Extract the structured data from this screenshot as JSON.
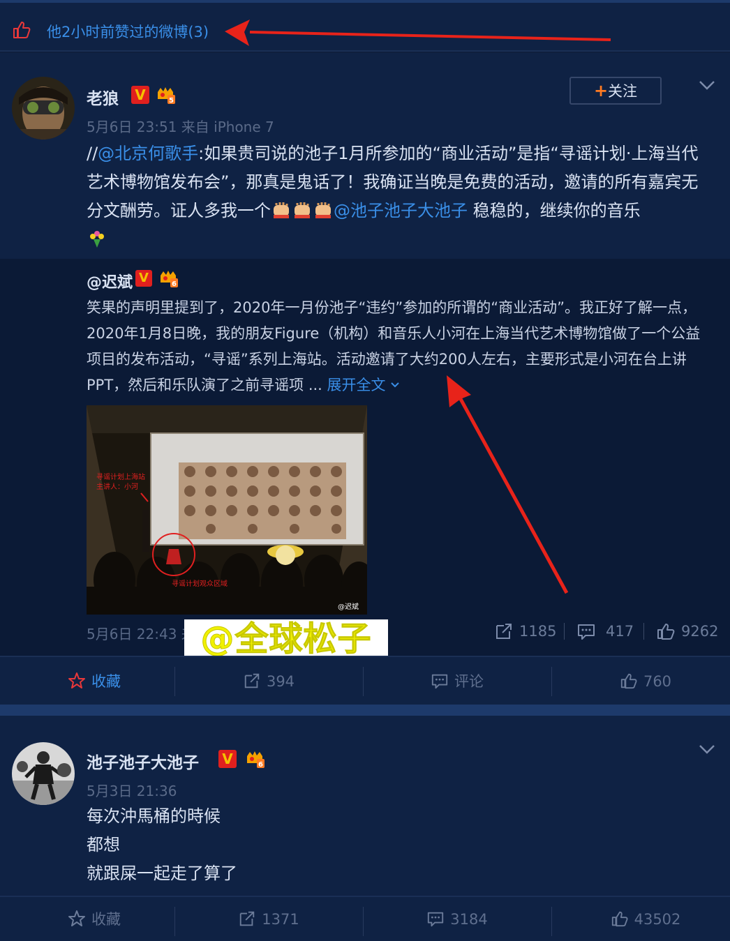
{
  "header": {
    "liked_text": "他2小时前赞过的微博(3)"
  },
  "post1": {
    "author": "老狼",
    "level": "5",
    "meta": "5月6日 23:51 来自 iPhone 7",
    "follow_label": "关注",
    "follow_plus": "+",
    "text_prefix": "//",
    "mention1": "@北京何歌手",
    "text_main": ":如果贵司说的池子1月所参加的“商业活动”是指“寻谣计划·上海当代艺术博物馆发布会”，那真是鬼话了！我确证当晚是免费的活动，邀请的所有嘉宾无分文酬劳。证人多我一个",
    "mention2": "@池子池子大池子",
    "text_end": " 稳稳的，继续你的音乐",
    "repost": {
      "author": "@迟斌",
      "level": "6",
      "text": "笑果的声明里提到了，2020年一月份池子“违约”参加的所谓的“商业活动”。我正好了解一点，2020年1月8日晚，我的朋友Figure（机构）和音乐人小河在上海当代艺术博物馆做了一个公益项目的发布活动，“寻谣”系列上海站。活动邀请了大约200人左右，主要形式是小河在台上讲PPT，然后和乐队演了之前寻谣项 ... ",
      "expand_label": "展开全文",
      "photo_caption_1": "寻谣计划上海站",
      "photo_caption_2": "主讲人：小河",
      "photo_caption_3": "寻谣计划观众区域",
      "photo_credit": "@迟斌",
      "meta": "5月6日 22:43 来",
      "reposts": "1185",
      "comments": "417",
      "likes": "9262"
    },
    "actions": {
      "favorite": "收藏",
      "repost": "394",
      "comment": "评论",
      "like": "760"
    }
  },
  "watermark": "@全球松子",
  "post2": {
    "author": "池子池子大池子",
    "level": "6",
    "meta": "5月3日 21:36",
    "lines": [
      "每次沖馬桶的時候",
      "都想",
      "就跟屎一起走了算了"
    ],
    "actions": {
      "favorite": "收藏",
      "repost": "1371",
      "comment": "3184",
      "like": "43502"
    }
  },
  "colors": {
    "background": "#0f2244",
    "link": "#3a8fe8",
    "annotation_arrow": "#e8231a"
  }
}
